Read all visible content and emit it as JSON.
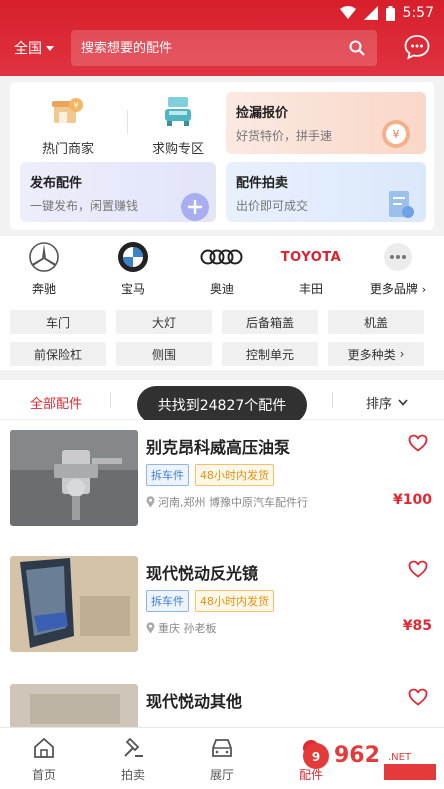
{
  "status": {
    "time": "5:57"
  },
  "header": {
    "region": "全国",
    "search_placeholder": "搜索想要的配件"
  },
  "quick_entries": [
    {
      "label": "热门商家",
      "icon": "shop-icon"
    },
    {
      "label": "求购专区",
      "icon": "car-wash-icon"
    }
  ],
  "tiles": {
    "price_quote": {
      "title": "捡漏报价",
      "subtitle": "好货特价，拼手速"
    },
    "publish": {
      "title": "发布配件",
      "subtitle": "一键发布，闲置赚钱"
    },
    "auction": {
      "title": "配件拍卖",
      "subtitle": "出价即可成交"
    }
  },
  "brands": [
    {
      "name": "奔驰",
      "icon": "mercedes-logo"
    },
    {
      "name": "宝马",
      "icon": "bmw-logo"
    },
    {
      "name": "奥迪",
      "icon": "audi-logo"
    },
    {
      "name": "丰田",
      "icon": "toyota-logo",
      "logo_text": "TOYOTA"
    },
    {
      "name": "更多品牌",
      "icon": "more-icon"
    }
  ],
  "categories": [
    "车门",
    "大灯",
    "后备箱盖",
    "机盖",
    "前保险杠",
    "侧围",
    "控制单元",
    "更多种类"
  ],
  "filter": {
    "all": "全部配件",
    "sort": "排序"
  },
  "toast": "共找到24827个配件",
  "listings": [
    {
      "title": "别克昂科威高压油泵",
      "tags": [
        "拆车件",
        "48小时内发货"
      ],
      "location": "河南,郑州 博豫中原汽车配件行",
      "price": "¥100"
    },
    {
      "title": "现代悦动反光镜",
      "tags": [
        "拆车件",
        "48小时内发货"
      ],
      "location": "重庆 孙老板",
      "price": "¥85"
    },
    {
      "title": "现代悦动其他",
      "tags": [],
      "location": "",
      "price": ""
    }
  ],
  "bottom_nav": [
    {
      "label": "首页",
      "icon": "home-icon"
    },
    {
      "label": "拍卖",
      "icon": "auction-hammer-icon"
    },
    {
      "label": "展厅",
      "icon": "car-icon"
    },
    {
      "label": "配件",
      "icon": "parts-icon",
      "active": true
    }
  ],
  "colors": {
    "brand_red": "#d71f2b",
    "price_red": "#e02a33"
  }
}
